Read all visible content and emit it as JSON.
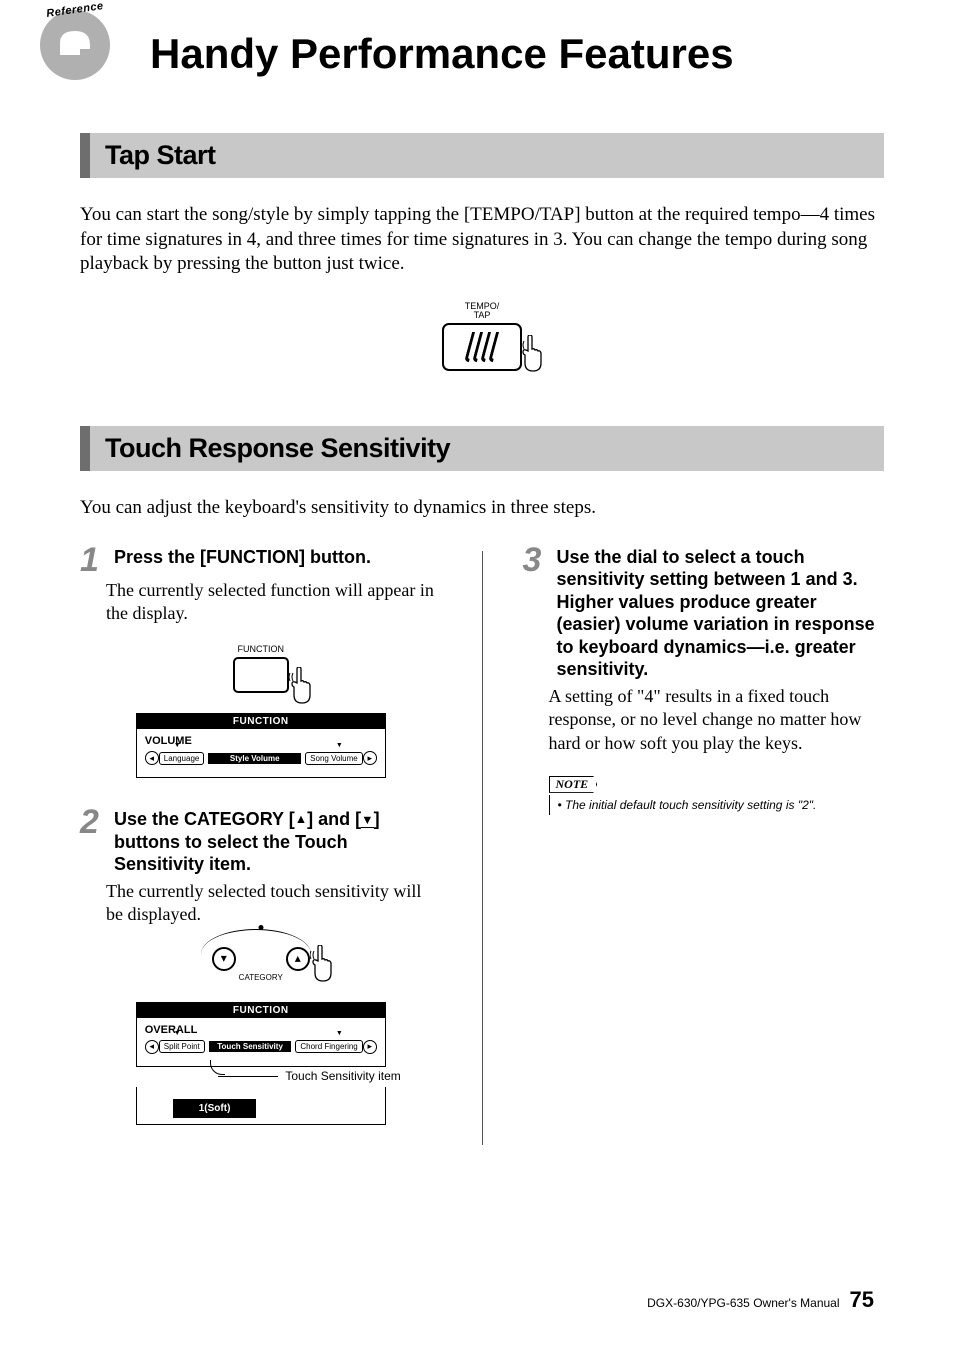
{
  "badge_text": "Reference",
  "page_title": "Handy Performance Features",
  "sections": {
    "tap_start": {
      "heading": "Tap Start",
      "body": "You can start the song/style by simply tapping the [TEMPO/TAP] button at the required tempo—4 times for time signatures in 4, and three times for time signatures in 3. You can change the tempo during song playback by pressing the button just twice.",
      "button_label_top": "TEMPO/",
      "button_label_bottom": "TAP"
    },
    "touch_response": {
      "heading": "Touch Response Sensitivity",
      "intro": "You can adjust the keyboard's sensitivity to dynamics in three steps.",
      "step1": {
        "num": "1",
        "head": "Press the [FUNCTION] button.",
        "body": "The currently selected function will appear in the display.",
        "button_label": "FUNCTION",
        "lcd_title": "FUNCTION",
        "lcd_section": "VOLUME",
        "lcd_left_pill": "Language",
        "lcd_center": "Style Volume",
        "lcd_right_pill": "Song Volume"
      },
      "step2": {
        "num": "2",
        "head_a": "Use the CATEGORY [",
        "head_b": "] and [",
        "head_c": "] buttons to select the Touch Sensitivity item.",
        "body": "The currently selected touch sensitivity will be displayed.",
        "cat_label": "CATEGORY",
        "lcd_title": "FUNCTION",
        "lcd_section": "OVERALL",
        "lcd_left_pill": "Split Point",
        "lcd_center": "Touch Sensitivity",
        "lcd_right_pill": "Chord Fingering",
        "callout": "Touch Sensitivity item",
        "lcd_value": "1(Soft)"
      },
      "step3": {
        "num": "3",
        "head": "Use the dial to select a touch sensitivity setting between 1 and 3. Higher values produce greater (easier) volume variation in response to keyboard dynamics—i.e. greater sensitivity.",
        "body": "A setting of \"4\" results in a fixed touch response, or no level change no matter how hard or how soft you play the keys.",
        "note_label": "NOTE",
        "note_body": "• The initial default touch sensitivity setting is \"2\"."
      }
    }
  },
  "footer": {
    "manual": "DGX-630/YPG-635  Owner's Manual",
    "page": "75"
  }
}
